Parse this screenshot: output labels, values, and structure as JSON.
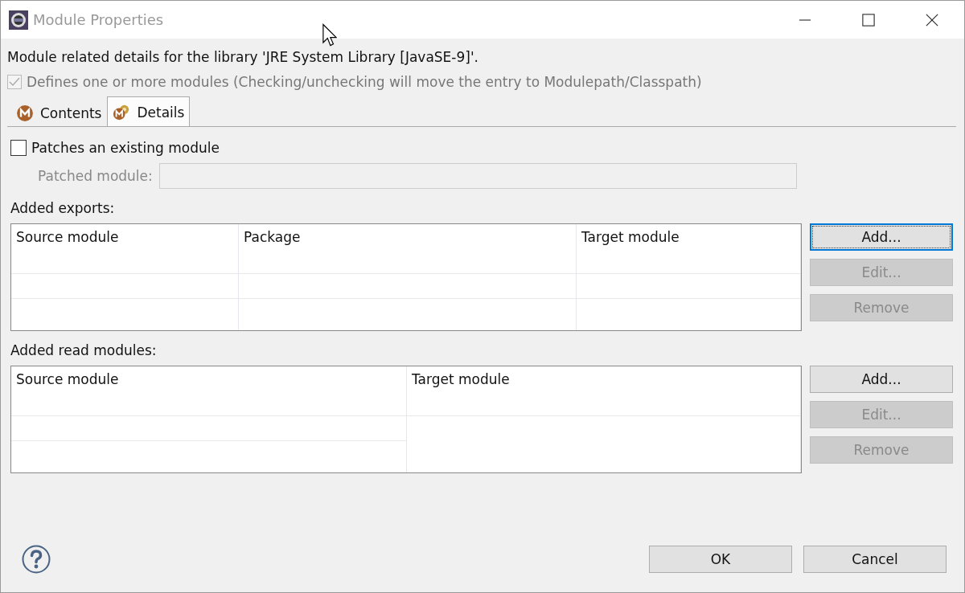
{
  "window": {
    "title": "Module Properties"
  },
  "description": "Module related details for the library 'JRE System Library [JavaSE-9]'.",
  "defines_modules": {
    "label": "Defines one or more modules (Checking/unchecking will move the entry to Modulepath/Classpath)",
    "checked": true,
    "disabled": true
  },
  "tabs": [
    {
      "label": "Contents",
      "selected": false,
      "kind": "module"
    },
    {
      "label": "Details",
      "selected": true,
      "kind": "module-gear"
    }
  ],
  "patches": {
    "label": "Patches an existing module",
    "checked": false
  },
  "patched_module": {
    "label": "Patched module:",
    "disabled": true
  },
  "sections": [
    {
      "label": "Added exports:",
      "columns": [
        "Source module",
        "Package",
        "Target module"
      ],
      "buttons": [
        {
          "label": "Add...",
          "disabled": false,
          "focused": true
        },
        {
          "label": "Edit...",
          "disabled": true,
          "focused": false
        },
        {
          "label": "Remove",
          "disabled": true,
          "focused": false
        }
      ]
    },
    {
      "label": "Added read modules:",
      "columns": [
        "Source module",
        "Target module"
      ],
      "buttons": [
        {
          "label": "Add...",
          "disabled": false,
          "focused": false
        },
        {
          "label": "Edit...",
          "disabled": true,
          "focused": false
        },
        {
          "label": "Remove",
          "disabled": true,
          "focused": false
        }
      ]
    }
  ],
  "footer_buttons": [
    "OK",
    "Cancel"
  ]
}
